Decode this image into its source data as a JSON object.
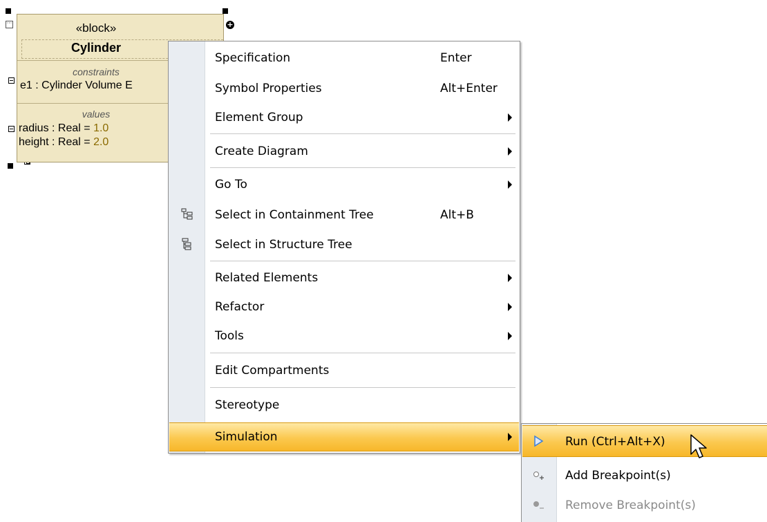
{
  "block": {
    "stereotype": "«block»",
    "name": "Cylinder",
    "constraints_title": "constraints",
    "constraint_line": "e1 : Cylinder Volume E",
    "values_title": "values",
    "values": [
      {
        "name": "radius : Real = ",
        "value": "1.0"
      },
      {
        "name": "height : Real = ",
        "value": "2.0"
      }
    ]
  },
  "context_menu": {
    "items": [
      {
        "label": "Specification",
        "shortcut": "Enter"
      },
      {
        "label": "Symbol Properties",
        "shortcut": "Alt+Enter"
      },
      {
        "label": "Element Group"
      },
      {
        "label": "Create Diagram"
      },
      {
        "label": "Go To"
      },
      {
        "label": "Select in Containment Tree",
        "shortcut": "Alt+B"
      },
      {
        "label": "Select in Structure Tree"
      },
      {
        "label": "Related Elements"
      },
      {
        "label": "Refactor"
      },
      {
        "label": "Tools"
      },
      {
        "label": "Edit Compartments"
      },
      {
        "label": "Stereotype"
      },
      {
        "label": "Simulation"
      }
    ]
  },
  "simulation_submenu": {
    "items": [
      {
        "label": "Run (Ctrl+Alt+X)"
      },
      {
        "label": "Add Breakpoint(s)"
      },
      {
        "label": "Remove Breakpoint(s)"
      }
    ]
  },
  "colors": {
    "block_fill": "#f0e7c4",
    "highlight": "#fbc84e",
    "gutter": "#e9edf2",
    "run_icon": "#3b7fd9"
  }
}
